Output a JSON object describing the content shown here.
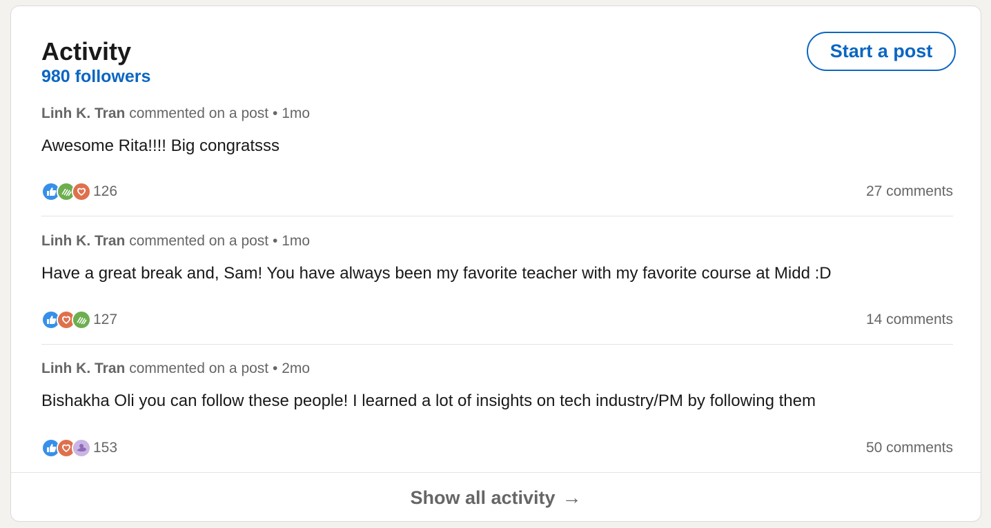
{
  "activity": {
    "title": "Activity",
    "followers": "980 followers",
    "start_post_label": "Start a post",
    "items": [
      {
        "author": "Linh K. Tran",
        "action": "commented on a post",
        "separator": "•",
        "time": "1mo",
        "text": "Awesome Rita!!!! Big congratsss",
        "reactions": [
          "like-icon",
          "support-icon",
          "love-icon"
        ],
        "reaction_count": "126",
        "comments": "27 comments"
      },
      {
        "author": "Linh K. Tran",
        "action": "commented on a post",
        "separator": "•",
        "time": "1mo",
        "text": "Have a great break and, Sam! You have always been my favorite teacher with my favorite course at Midd :D",
        "reactions": [
          "like-icon",
          "love-icon",
          "support-icon"
        ],
        "reaction_count": "127",
        "comments": "14 comments"
      },
      {
        "author": "Linh K. Tran",
        "action": "commented on a post",
        "separator": "•",
        "time": "2mo",
        "text": "Bishakha Oli you can follow these people! I learned a lot of insights on tech industry/PM by following them",
        "reactions": [
          "like-icon",
          "love-icon",
          "insightful-icon"
        ],
        "reaction_count": "153",
        "comments": "50 comments"
      }
    ],
    "show_all_label": "Show all activity",
    "show_all_arrow": "→"
  },
  "colors": {
    "accent": "#0a66c2",
    "like": "#378fe9",
    "love": "#df704d",
    "support": "#6dae4f",
    "insightful": "#8f6ab6"
  }
}
